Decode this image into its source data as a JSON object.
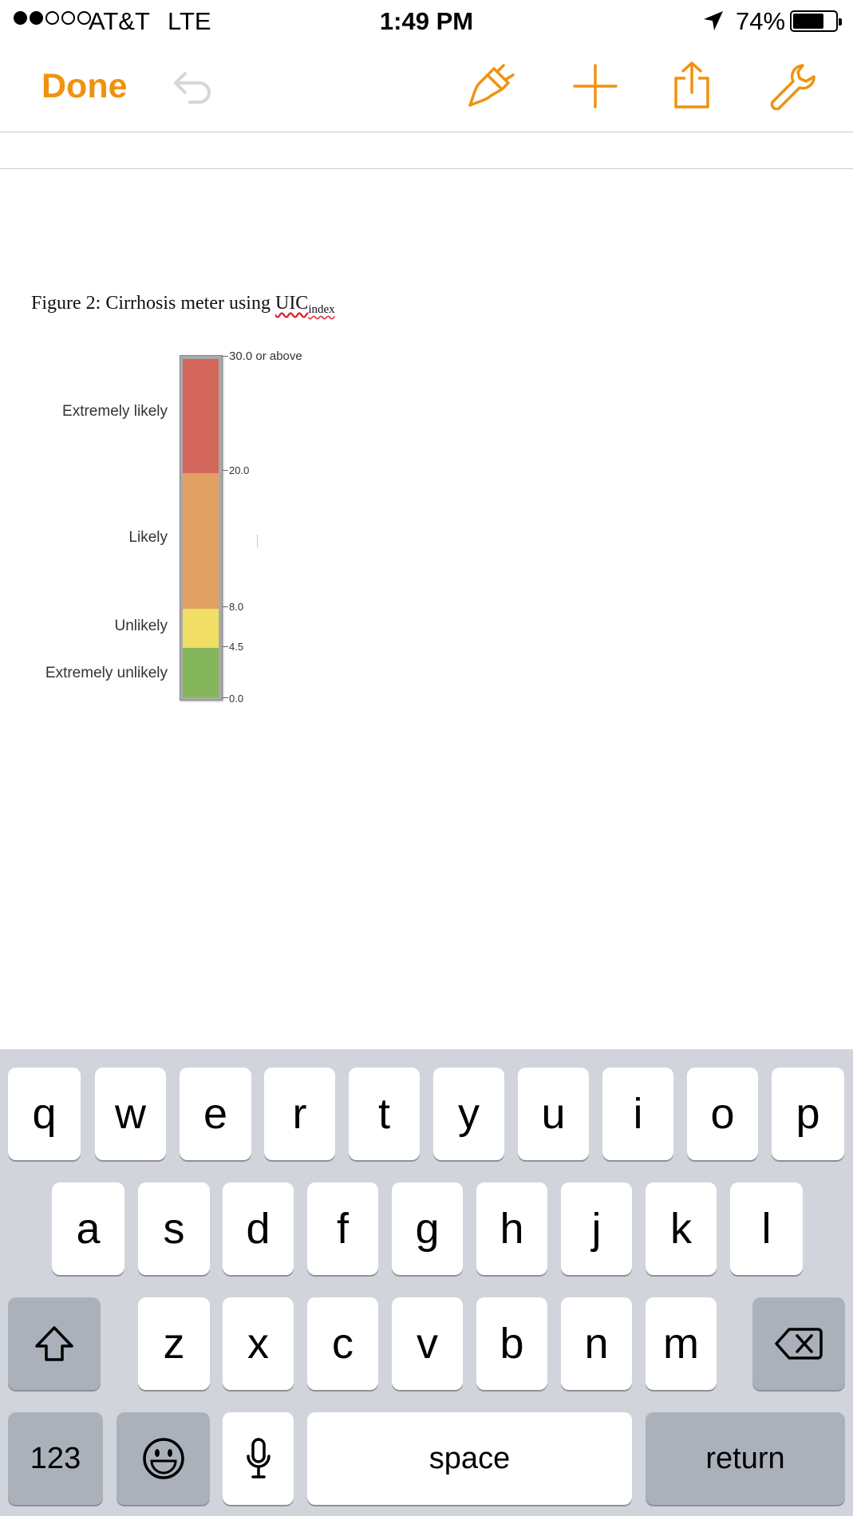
{
  "status_bar": {
    "carrier": "AT&T",
    "network": "LTE",
    "time": "1:49 PM",
    "battery_percent": "74%",
    "battery_level": 0.74,
    "signal_bars_filled": 2,
    "signal_bars_total": 5
  },
  "toolbar": {
    "done_label": "Done",
    "icons": [
      "undo-icon",
      "paintbrush-icon",
      "plus-icon",
      "share-icon",
      "wrench-icon"
    ],
    "accent_color": "#f0920f"
  },
  "document": {
    "caption_prefix": "Figure 2: Cirrhosis meter using ",
    "caption_uic": "UIC",
    "caption_sub": "index",
    "meter": {
      "labels": [
        "Extremely likely",
        "Likely",
        "Unlikely",
        "Extremely unlikely"
      ],
      "ticks": [
        "30.0 or above",
        "20.0",
        "8.0",
        "4.5",
        "0.0"
      ],
      "colors": [
        "#d3665a",
        "#e2a062",
        "#f0de65",
        "#86b65c"
      ]
    }
  },
  "keyboard": {
    "row1": [
      "q",
      "w",
      "e",
      "r",
      "t",
      "y",
      "u",
      "i",
      "o",
      "p"
    ],
    "row2": [
      "a",
      "s",
      "d",
      "f",
      "g",
      "h",
      "j",
      "k",
      "l"
    ],
    "row3": [
      "z",
      "x",
      "c",
      "v",
      "b",
      "n",
      "m"
    ],
    "numbers_label": "123",
    "space_label": "space",
    "return_label": "return"
  }
}
